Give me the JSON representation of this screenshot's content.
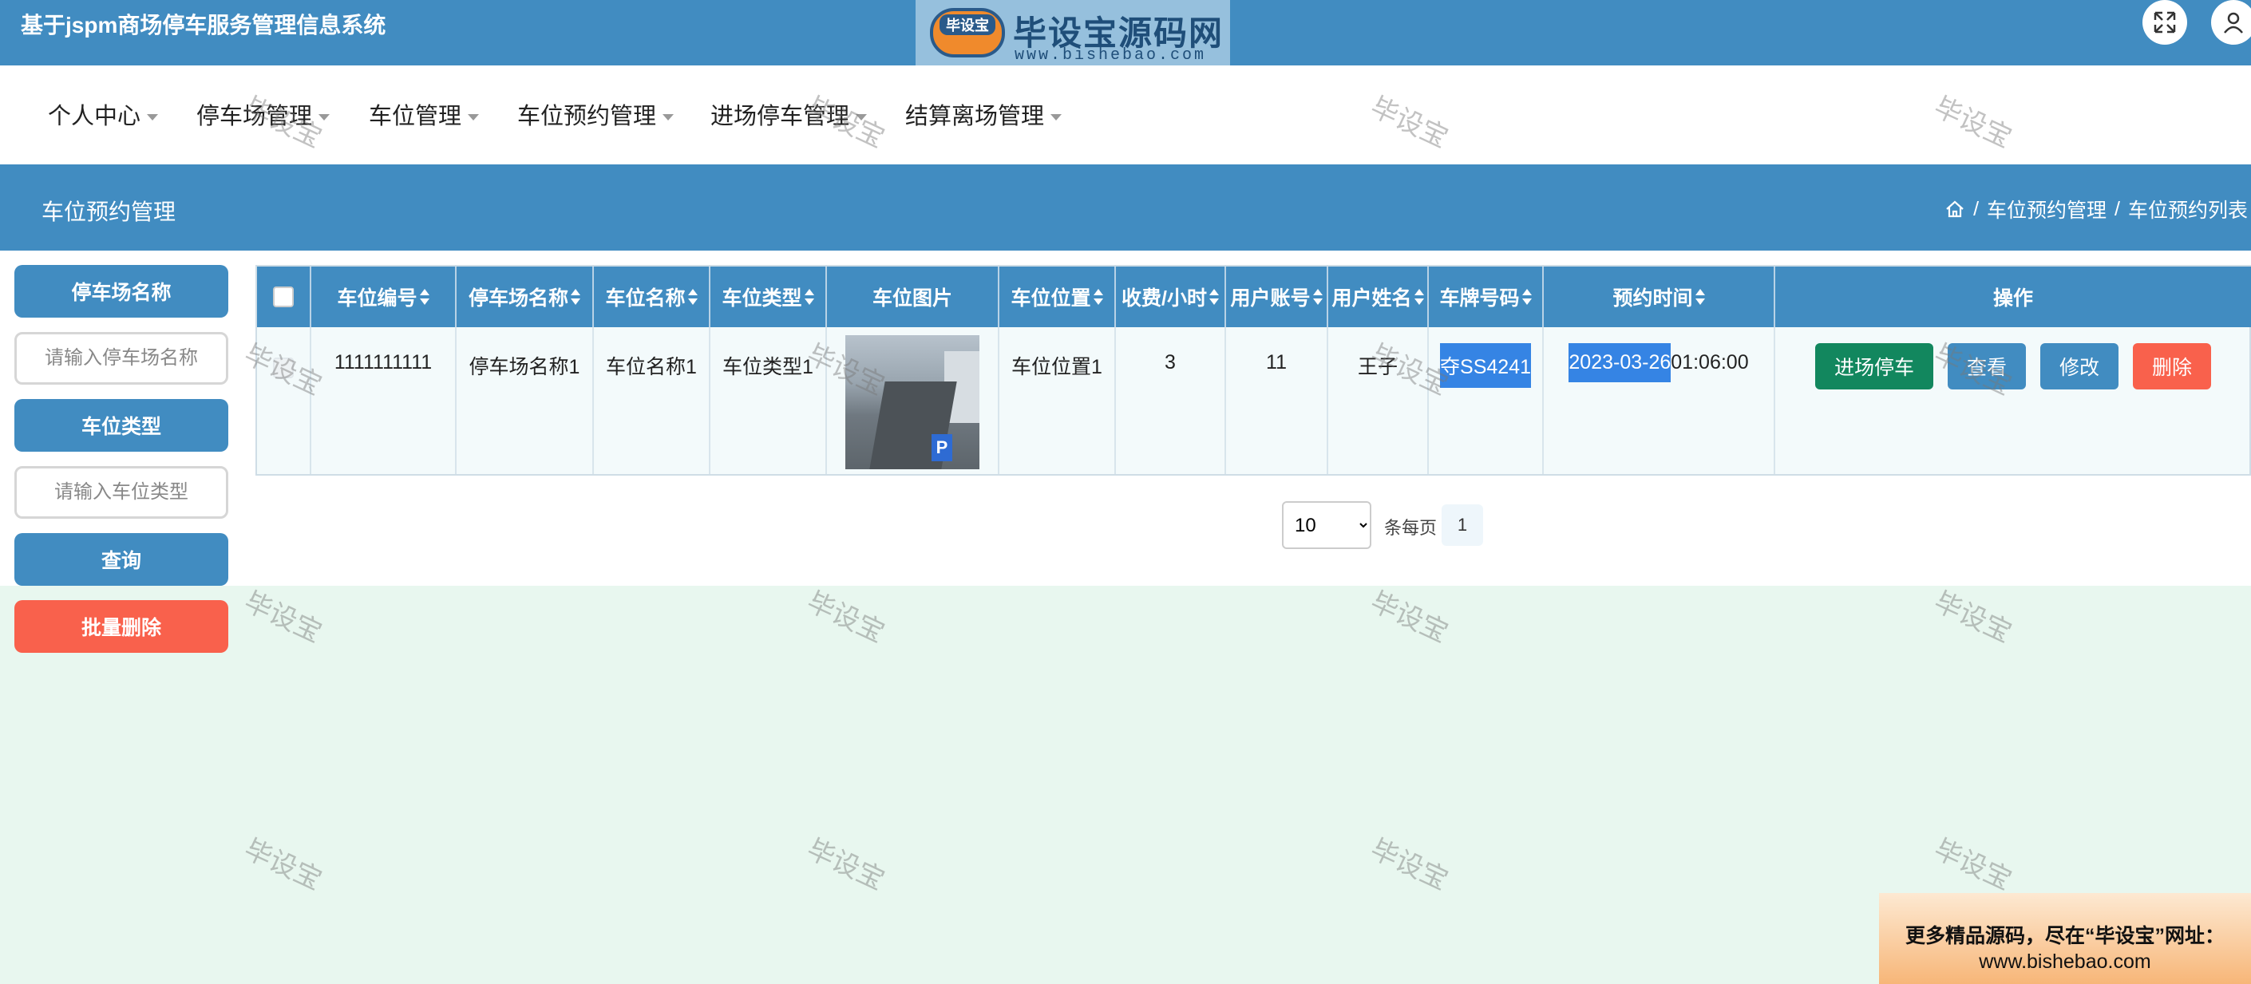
{
  "app": {
    "title": "基于jspm商场停车服务管理信息系统"
  },
  "logo": {
    "badge": "毕设宝",
    "main": "毕设宝源码网",
    "sub": "www.bishebao.com"
  },
  "icons": {
    "fullscreen": "expand-icon",
    "user": "user-icon",
    "home": "home-icon"
  },
  "nav": {
    "items": [
      {
        "label": "个人中心"
      },
      {
        "label": "停车场管理"
      },
      {
        "label": "车位管理"
      },
      {
        "label": "车位预约管理"
      },
      {
        "label": "进场停车管理"
      },
      {
        "label": "结算离场管理"
      }
    ]
  },
  "section": {
    "title": "车位预约管理",
    "breadcrumb": {
      "parent": "车位预约管理",
      "current": "车位预约列表",
      "sep": "/"
    }
  },
  "filters": {
    "lot_name_label": "停车场名称",
    "lot_name_placeholder": "请输入停车场名称",
    "space_type_label": "车位类型",
    "space_type_placeholder": "请输入车位类型",
    "search_label": "查询",
    "batch_delete_label": "批量删除"
  },
  "table": {
    "headers": {
      "space_no": "车位编号",
      "lot_name": "停车场名称",
      "space_name": "车位名称",
      "space_type": "车位类型",
      "space_image": "车位图片",
      "space_location": "车位位置",
      "fee_per_hour": "收费/小时",
      "user_account": "用户账号",
      "user_name": "用户姓名",
      "plate_no": "车牌号码",
      "reserve_time": "预约时间",
      "actions": "操作"
    },
    "rows": [
      {
        "space_no": "1111111111",
        "lot_name": "停车场名称1",
        "space_name": "车位名称1",
        "space_type": "车位类型1",
        "space_location": "车位位置1",
        "fee_per_hour": "3",
        "user_account": "11",
        "user_name": "王子",
        "plate_no": "夺SS4241",
        "reserve_date": "2023-03-26",
        "reserve_clock": " 01:06:00"
      }
    ],
    "actions": {
      "enter": "进场停车",
      "view": "查看",
      "edit": "修改",
      "delete": "删除"
    }
  },
  "pagination": {
    "page_size": "10",
    "per_page_label": "条每页",
    "current_page": "1"
  },
  "watermark": "毕设宝",
  "ad": {
    "line1": "更多精品源码，尽在“毕设宝”网址：",
    "line2": "www.bishebao.com"
  },
  "colors": {
    "primary": "#418cc1",
    "enter_button": "#12875e",
    "view_button": "#418cc1",
    "delete_button": "#f9614c",
    "batch_delete": "#f9614c",
    "selection": "#3584e4"
  }
}
